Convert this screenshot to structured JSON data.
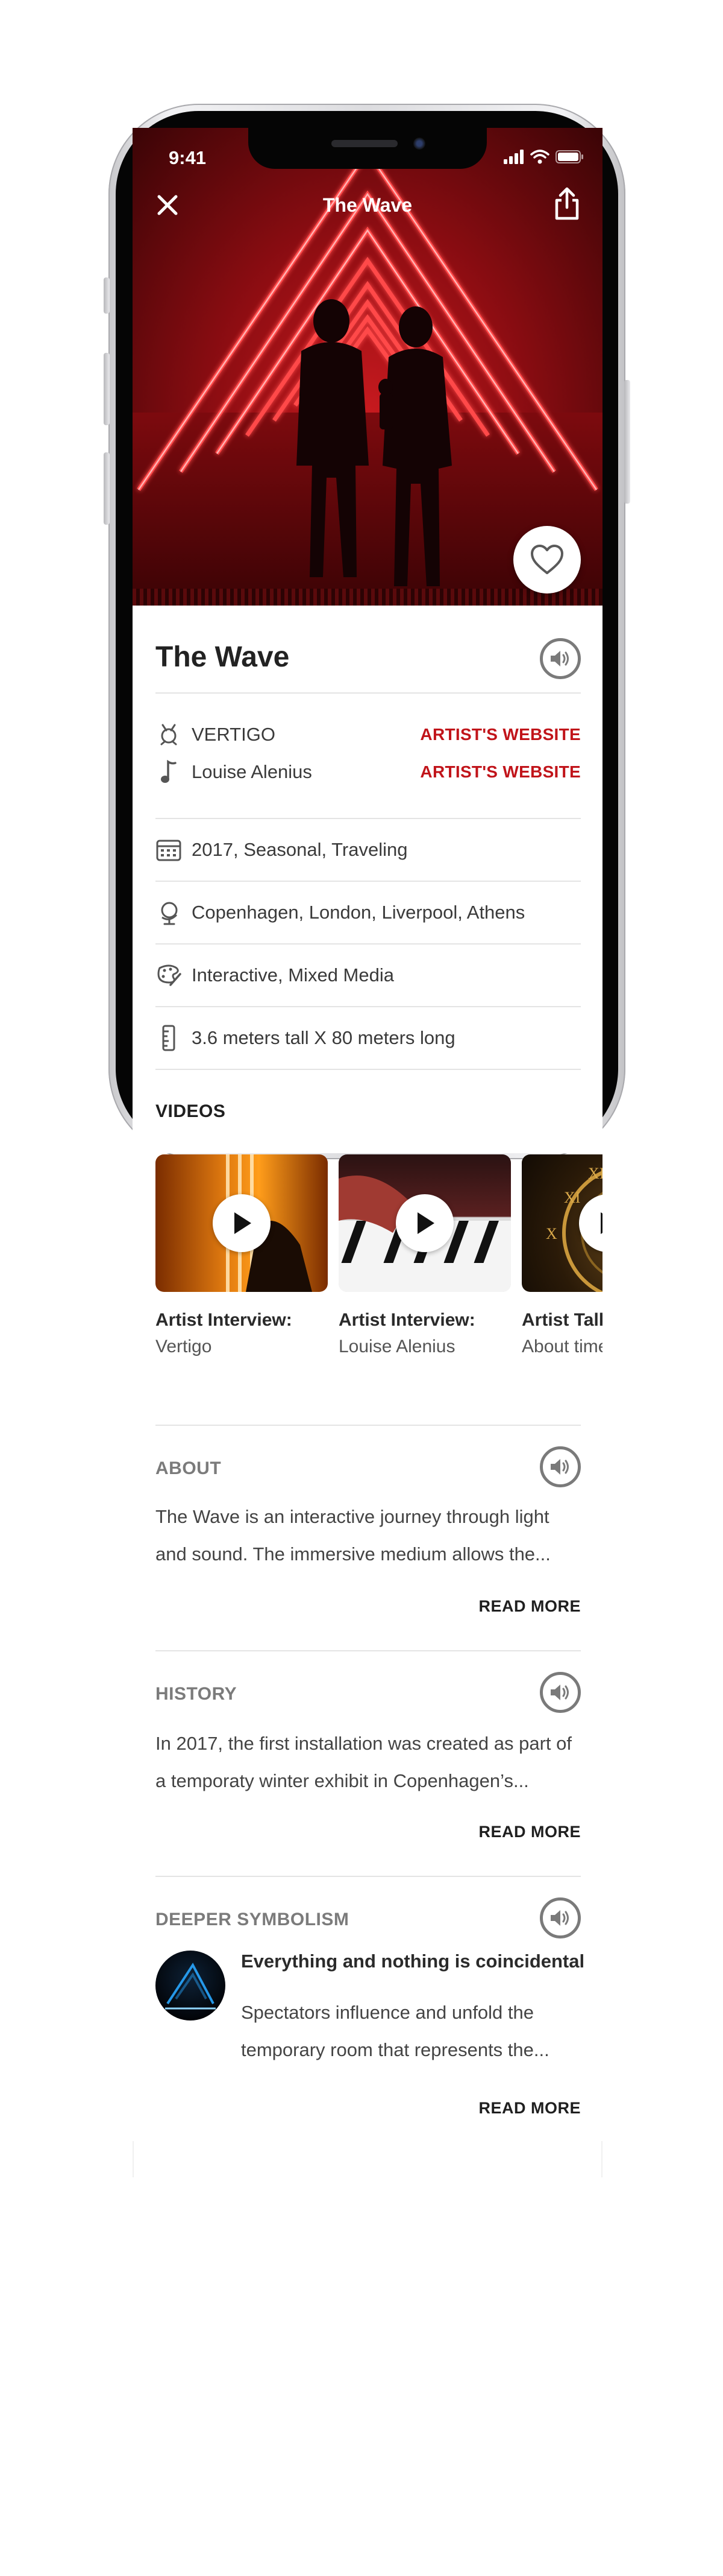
{
  "status_bar": {
    "time": "9:41"
  },
  "header": {
    "title": "The Wave"
  },
  "hero": {
    "favorite": false
  },
  "details": {
    "title": "The Wave",
    "artists": [
      {
        "name": "VERTIGO",
        "icon": "mask-icon",
        "link": "ARTIST'S WEBSITE"
      },
      {
        "name": "Louise Alenius",
        "icon": "music-note-icon",
        "link": "ARTIST'S WEBSITE"
      }
    ],
    "rows": [
      {
        "icon": "calendar-icon",
        "text": "2017, Seasonal, Traveling"
      },
      {
        "icon": "globe-icon",
        "text": "Copenhagen, London, Liverpool, Athens"
      },
      {
        "icon": "palette-icon",
        "text": "Interactive, Mixed Media"
      },
      {
        "icon": "ruler-icon",
        "text": "3.6 meters tall X 80 meters long"
      }
    ]
  },
  "videos": {
    "label": "VIDEOS",
    "items": [
      {
        "title": "Artist Interview:",
        "subtitle": "Vertigo"
      },
      {
        "title": "Artist Interview:",
        "subtitle": "Louise Alenius"
      },
      {
        "title": "Artist Talk:",
        "subtitle": "About time"
      }
    ]
  },
  "about": {
    "label": "ABOUT",
    "text": "The Wave is an interactive journey through light and sound. The immersive medium allows the...",
    "read_more": "READ MORE"
  },
  "history": {
    "label": "HISTORY",
    "text": "In 2017, the first installation was created as part of a temporaty winter exhibit in Copenhagen’s...",
    "read_more": "READ MORE"
  },
  "symbolism": {
    "label": "DEEPER SYMBOLISM",
    "title": "Everything and nothing is coincidental",
    "text": "Spectators  influence and unfold the temporary room that represents the...",
    "read_more": "READ MORE"
  },
  "colors": {
    "accent_red": "#c1141a",
    "muted_gray": "#7b7b7b",
    "text_dark": "#222222"
  }
}
